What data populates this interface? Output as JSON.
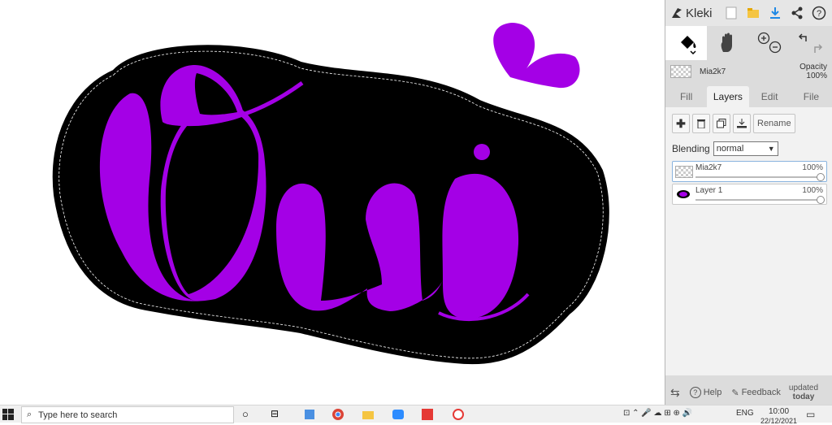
{
  "app": {
    "name": "Kleki",
    "toolbar_icons": [
      "new-image-icon",
      "open-folder-icon",
      "download-icon",
      "share-icon",
      "help-icon"
    ],
    "tools": [
      "paint-bucket-icon",
      "hand-icon",
      "zoom-in-icon",
      "zoom-out-icon",
      "undo-icon",
      "redo-icon"
    ],
    "active_layer": {
      "name": "Mia2k7",
      "opacity_label": "Opacity",
      "opacity_value": "100%"
    },
    "tabs": [
      {
        "label": "Fill",
        "active": false
      },
      {
        "label": "Layers",
        "active": true
      },
      {
        "label": "Edit",
        "active": false
      },
      {
        "label": "File",
        "active": false
      }
    ],
    "layer_actions": {
      "rename": "Rename"
    },
    "blending": {
      "label": "Blending",
      "value": "normal"
    },
    "layers": [
      {
        "name": "Mia2k7",
        "opacity": "100%",
        "selected": true
      },
      {
        "name": "Layer 1",
        "opacity": "100%",
        "selected": false
      }
    ],
    "bottom": {
      "help": "Help",
      "feedback": "Feedback",
      "updated_line1": "updated",
      "updated_line2": "today"
    }
  },
  "colors": {
    "purple": "#a400e6",
    "panel": "#dcdcdc",
    "accent": "#1e88e5"
  },
  "taskbar": {
    "search_placeholder": "Type here to search",
    "language": "ENG",
    "time": "10:00",
    "date": "22/12/2021"
  }
}
